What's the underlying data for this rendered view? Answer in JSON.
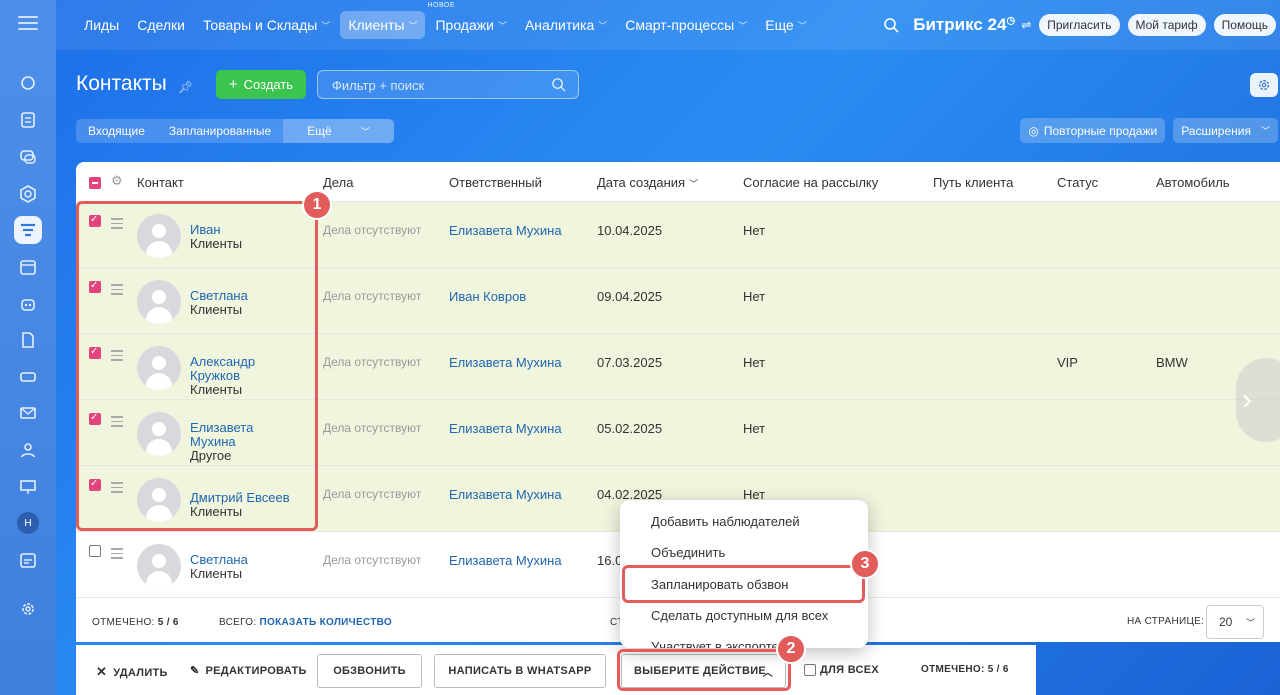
{
  "nav": {
    "items": [
      "Лиды",
      "Сделки",
      "Товары и Склады",
      "Клиенты",
      "Продажи",
      "Аналитика",
      "Смарт-процессы",
      "Еще"
    ],
    "new_label": "НОВОЕ",
    "logo": "Битрикс 24",
    "invite": "Пригласить",
    "tariff": "Мой тариф",
    "help": "Помощь"
  },
  "sidebar": {
    "user_initial": "Н"
  },
  "page": {
    "title": "Контакты",
    "create_button": "Создать",
    "search_placeholder": "Фильтр + поиск",
    "filters": [
      "Входящие",
      "Запланированные",
      "Ещё"
    ],
    "repeat_sales": "Повторные продажи",
    "extensions": "Расширения"
  },
  "table": {
    "columns": [
      "Контакт",
      "Дела",
      "Ответственный",
      "Дата создания",
      "Согласие на рассылку",
      "Путь клиента",
      "Статус",
      "Автомобиль"
    ],
    "rows": [
      {
        "name": "Иван",
        "type": "Клиенты",
        "deals": "Дела отсутствуют",
        "owner": "Елизавета Мухина",
        "date": "10.04.2025",
        "consent": "Нет",
        "status": "",
        "car": "",
        "selected": true
      },
      {
        "name": "Светлана",
        "type": "Клиенты",
        "deals": "Дела отсутствуют",
        "owner": "Иван Ковров",
        "date": "09.04.2025",
        "consent": "Нет",
        "status": "",
        "car": "",
        "selected": true
      },
      {
        "name": "Александр Кружков",
        "type": "Клиенты",
        "deals": "Дела отсутствуют",
        "owner": "Елизавета Мухина",
        "date": "07.03.2025",
        "consent": "Нет",
        "status": "VIP",
        "car": "BMW",
        "selected": true
      },
      {
        "name": "Елизавета Мухина",
        "type": "Другое",
        "deals": "Дела отсутствуют",
        "owner": "Елизавета Мухина",
        "date": "05.02.2025",
        "consent": "Нет",
        "status": "",
        "car": "",
        "selected": true
      },
      {
        "name": "Дмитрий Евсеев",
        "type": "Клиенты",
        "deals": "Дела отсутствуют",
        "owner": "Елизавета Мухина",
        "date": "04.02.2025",
        "consent": "Нет",
        "status": "",
        "car": "",
        "selected": true
      },
      {
        "name": "Светлана",
        "type": "Клиенты",
        "deals": "Дела отсутствуют",
        "owner": "Елизавета Мухина",
        "date": "16.0",
        "consent": "",
        "status": "",
        "car": "",
        "selected": false
      }
    ],
    "footer": {
      "marked_label": "ОТМЕЧЕНО:",
      "marked_value": "5 / 6",
      "total_label": "ВСЕГО:",
      "total_link": "ПОКАЗАТЬ КОЛИЧЕСТВО",
      "page_fragment": "СТ",
      "per_page_label": "НА СТРАНИЦЕ:",
      "per_page_value": "20"
    }
  },
  "dropdown": {
    "items": [
      "Добавить наблюдателей",
      "Объединить",
      "Запланировать обзвон",
      "Сделать доступным для всех",
      "Участвует в экспорте"
    ]
  },
  "bottombar": {
    "delete": "УДАЛИТЬ",
    "edit": "РЕДАКТИРОВАТЬ",
    "call": "ОБЗВОНИТЬ",
    "whatsapp": "НАПИСАТЬ В WHATSAPP",
    "choose_action": "ВЫБЕРИТЕ ДЕЙСТВИЕ",
    "for_all": "ДЛЯ ВСЕХ",
    "marked_label": "ОТМЕЧЕНО:",
    "marked_value": "5 / 6"
  },
  "badges": [
    "1",
    "2",
    "3"
  ],
  "colors": {
    "accent_green": "#3bc44e",
    "highlight_red": "#e25c5c",
    "checkbox_pink": "#e2447c",
    "selected_row": "#f0f6de",
    "link_blue": "#2066b0"
  }
}
